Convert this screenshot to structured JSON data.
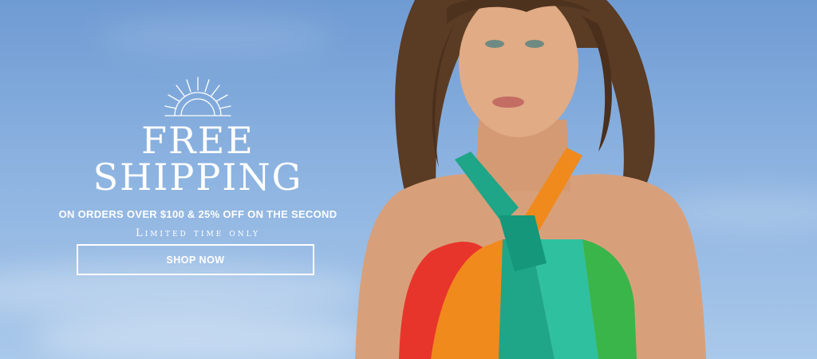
{
  "banner": {
    "headline": "FREE SHIPPING",
    "subheadline": "ON ORDERS OVER $100 & 25% OFF ON THE SECOND",
    "tagline": "Limited time only",
    "cta_label": "SHOP NOW",
    "icon": "sunburst-icon"
  },
  "colors": {
    "sky_top": "#6f9bd3",
    "sky_bottom": "#a9c8ea",
    "text": "#ffffff",
    "scarf_red": "#e8352b",
    "scarf_orange": "#f08a1c",
    "scarf_teal": "#1fa587",
    "scarf_green": "#39b54a"
  }
}
